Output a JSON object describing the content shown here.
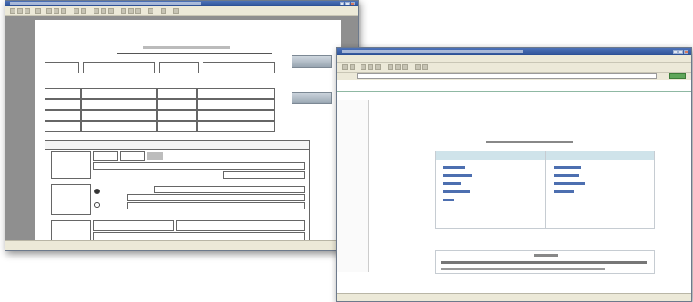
{
  "back_window": {
    "title": "",
    "status": ""
  },
  "front_window": {
    "title": "",
    "address": "",
    "status": ""
  }
}
